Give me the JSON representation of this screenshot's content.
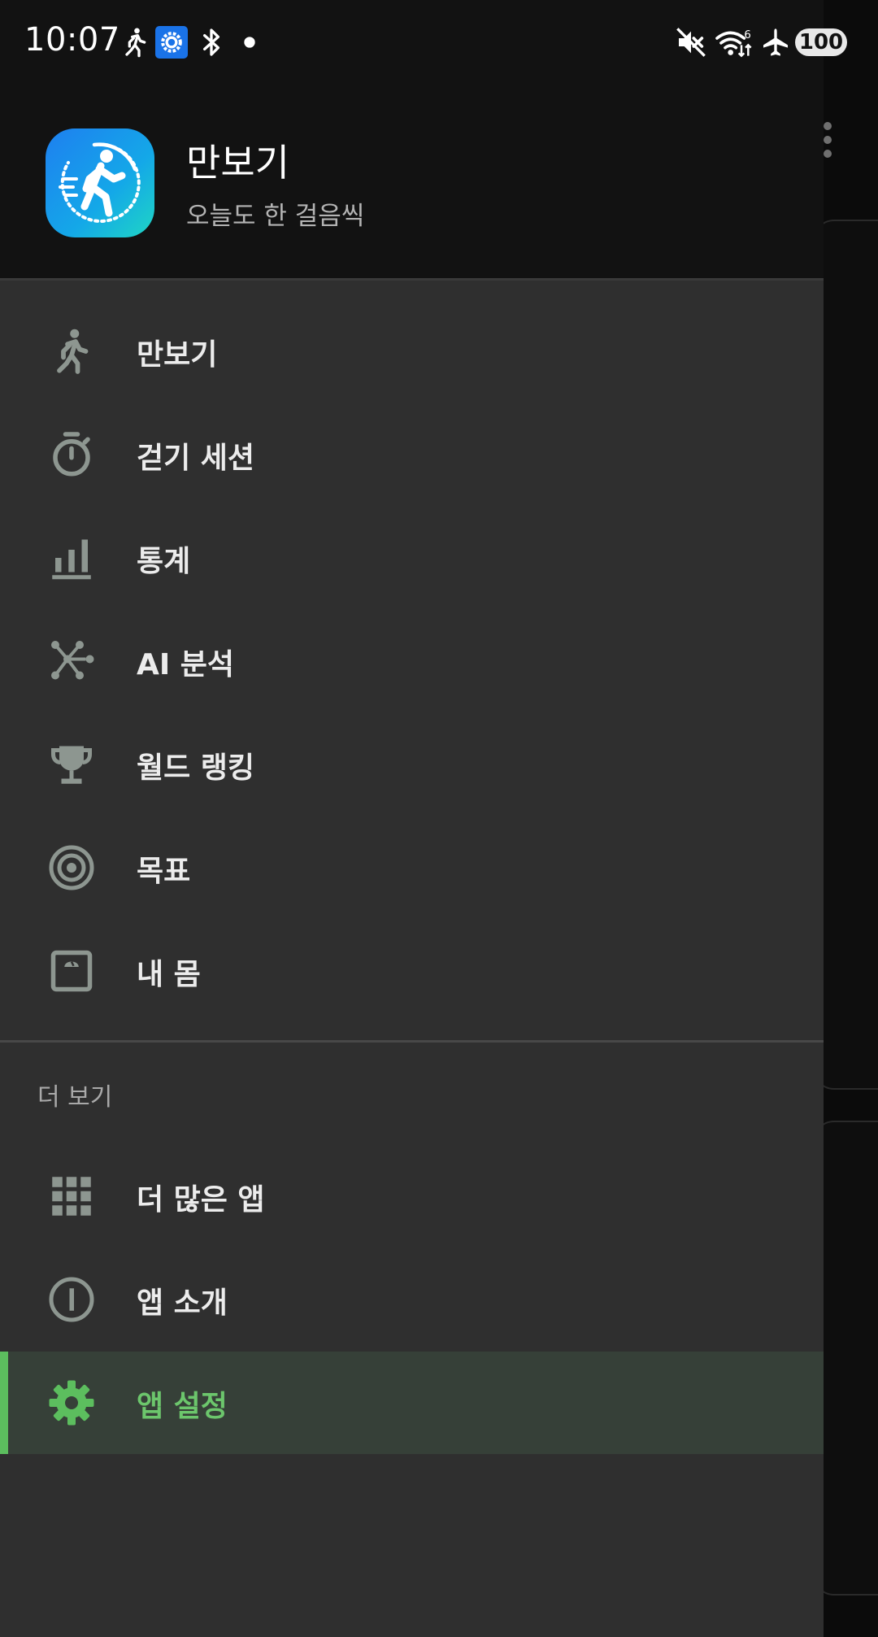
{
  "status_bar": {
    "time": "10:07",
    "network_badge": "6",
    "battery": "100",
    "icons": [
      "walking-icon",
      "settings-notification-icon",
      "bluetooth-icon",
      "dot-icon",
      "mute-icon",
      "wifi-icon",
      "airplane-icon",
      "battery-icon"
    ]
  },
  "drawer": {
    "header": {
      "app_name": "만보기",
      "tagline": "오늘도 한 걸음씩"
    },
    "main_items": [
      {
        "label": "만보기",
        "icon": "walking-icon"
      },
      {
        "label": "걷기 세션",
        "icon": "stopwatch-icon"
      },
      {
        "label": "통계",
        "icon": "bar-chart-icon"
      },
      {
        "label": "AI 분석",
        "icon": "network-icon"
      },
      {
        "label": "월드 랭킹",
        "icon": "trophy-icon"
      },
      {
        "label": "목표",
        "icon": "target-icon"
      },
      {
        "label": "내 몸",
        "icon": "scale-icon"
      }
    ],
    "section_title": "더 보기",
    "more_items": [
      {
        "label": "더 많은 앱",
        "icon": "grid-icon"
      },
      {
        "label": "앱 소개",
        "icon": "info-icon"
      },
      {
        "label": "앱 설정",
        "icon": "gear-icon",
        "selected": true
      }
    ]
  },
  "colors": {
    "drawer_bg": "#2f2f2f",
    "header_bg": "#121212",
    "icon_gray": "#8d9690",
    "accent_green": "#5cbe5e",
    "selected_bg": "#364038"
  }
}
